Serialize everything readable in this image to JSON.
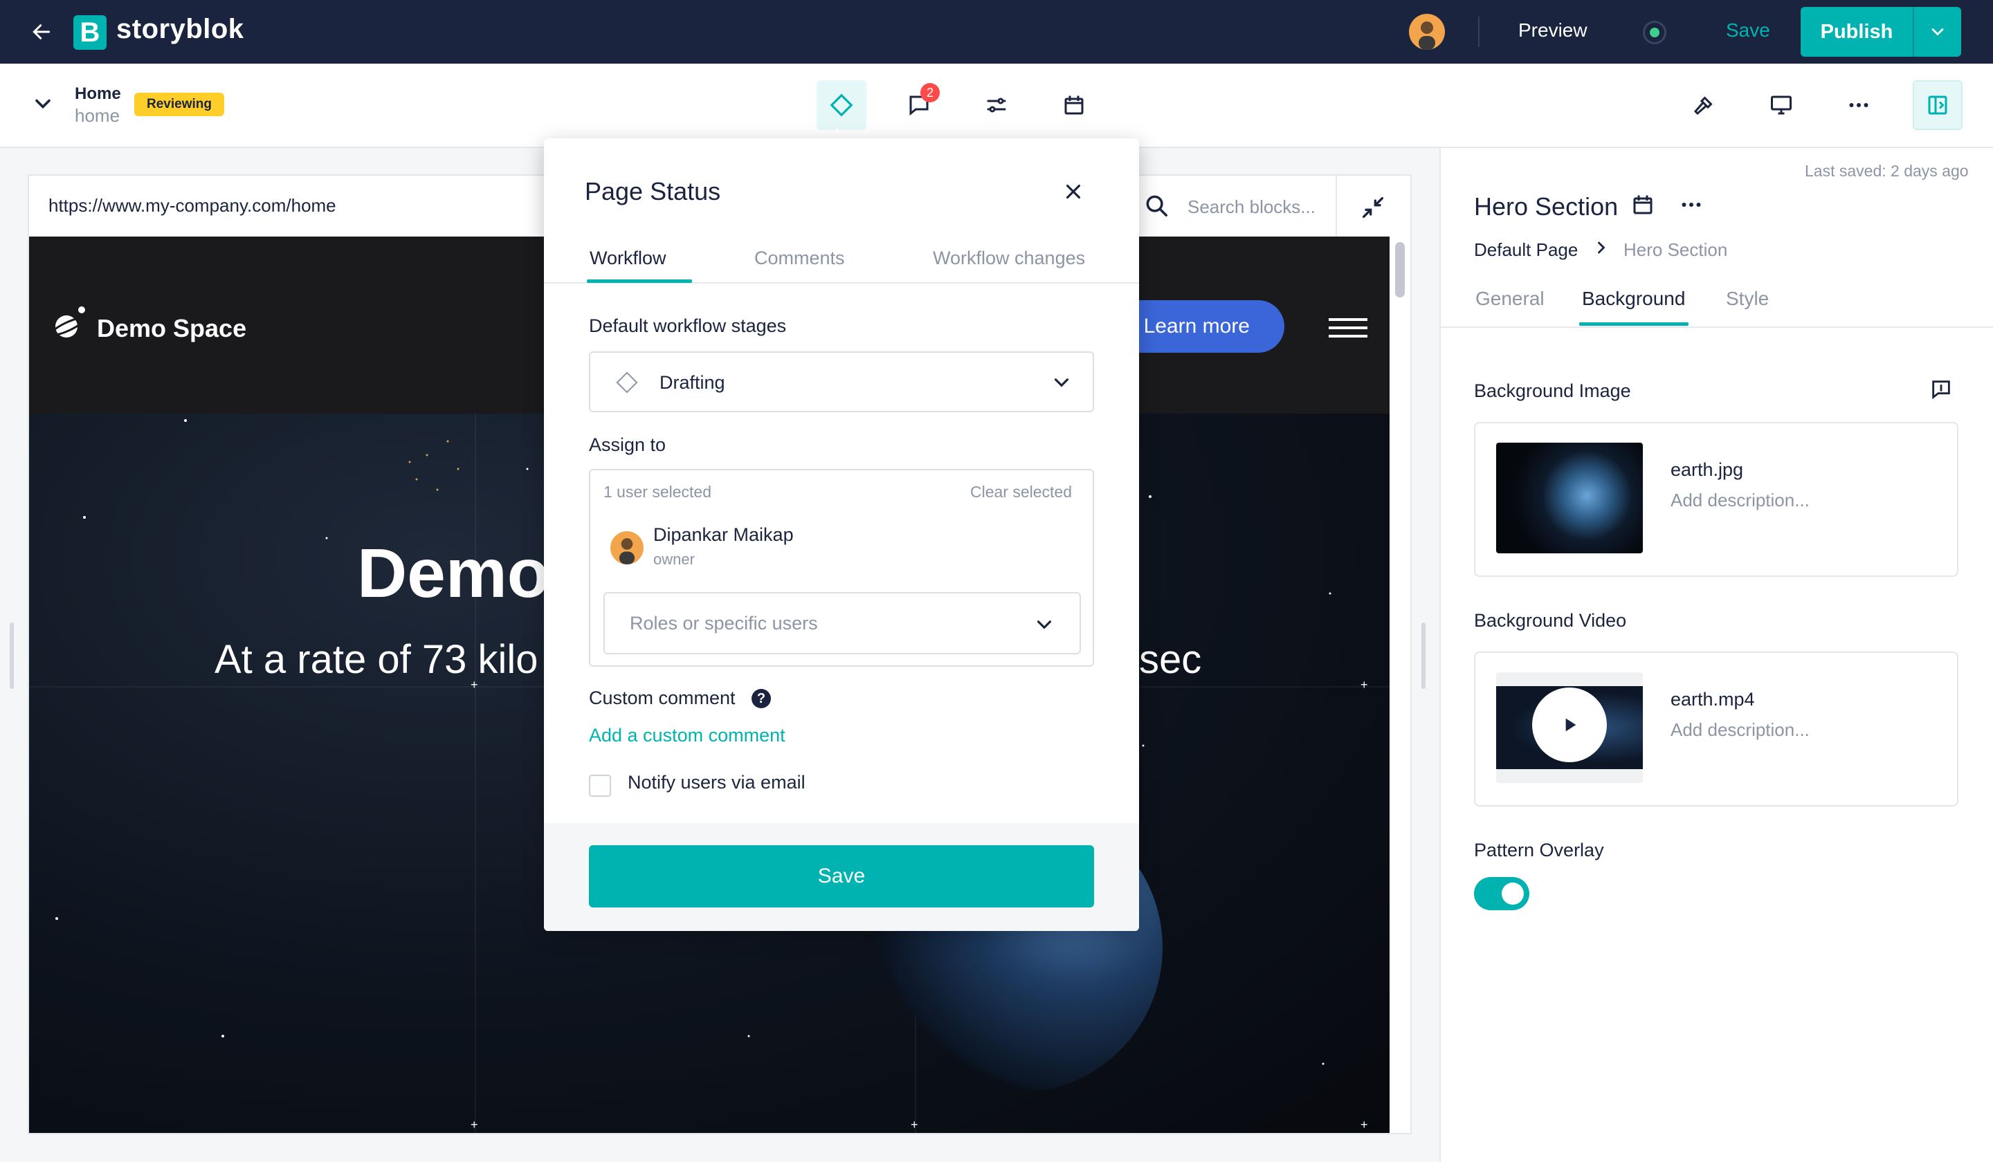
{
  "topbar": {
    "logo_letter": "B",
    "app_name": "storyblok",
    "preview_label": "Preview",
    "save_label": "Save",
    "publish_label": "Publish"
  },
  "subbar": {
    "story_title": "Home",
    "story_slug": "home",
    "status_badge": "Reviewing",
    "comments_count": "2"
  },
  "preview": {
    "url": "https://www.my-company.com/home",
    "search_placeholder": "Search blocks...",
    "site_name": "Demo Space",
    "learn_more": "Learn more",
    "hero_heading": "Demo",
    "hero_subtitle_left": "At a rate of 73 kilo",
    "hero_subtitle_right": "sec"
  },
  "modal": {
    "title": "Page Status",
    "tabs": [
      "Workflow",
      "Comments",
      "Workflow changes"
    ],
    "stages_label": "Default workflow stages",
    "stage_value": "Drafting",
    "assign_label": "Assign to",
    "users_selected": "1 user selected",
    "clear_selected": "Clear selected",
    "user_name": "Dipankar Maikap",
    "user_role": "owner",
    "roles_placeholder": "Roles or specific users",
    "custom_comment_label": "Custom comment",
    "help_glyph": "?",
    "add_comment_link": "Add a custom comment",
    "notify_label": "Notify users via email",
    "save_label": "Save"
  },
  "panel": {
    "last_saved": "Last saved: 2 days ago",
    "title": "Hero Section",
    "breadcrumb": [
      "Default Page",
      "Hero Section"
    ],
    "tabs": [
      "General",
      "Background",
      "Style"
    ],
    "bg_image_label": "Background Image",
    "bg_image_name": "earth.jpg",
    "bg_image_desc": "Add description...",
    "bg_video_label": "Background Video",
    "bg_video_name": "earth.mp4",
    "bg_video_desc": "Add description...",
    "pattern_label": "Pattern Overlay",
    "pattern_on": true
  },
  "colors": {
    "brand": "#00b3b0",
    "topbar": "#1b243f",
    "badge": "#ffce29",
    "notif": "#ff4a4a",
    "cta_blue": "#3a66d9"
  },
  "icons": [
    "back-arrow-icon",
    "avatar",
    "status-dot-icon",
    "chevron-down-icon",
    "diamond-workflow-icon",
    "comment-icon",
    "settings-sliders-icon",
    "calendar-icon",
    "hammer-icon",
    "monitor-icon",
    "more-icon",
    "sidebar-toggle-icon",
    "search-icon",
    "collapse-icon",
    "close-icon",
    "play-icon"
  ]
}
